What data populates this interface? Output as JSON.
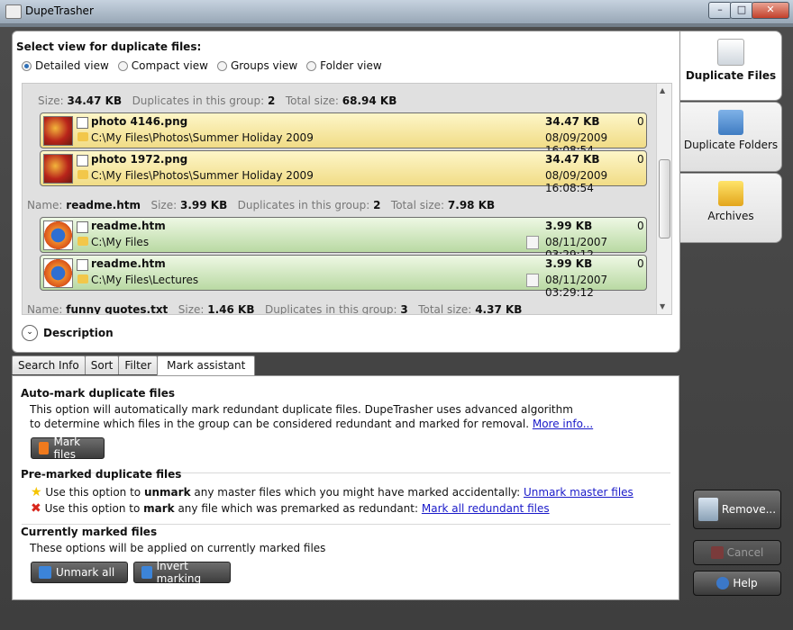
{
  "window": {
    "title": "DupeTrasher",
    "min": "–",
    "max": "□",
    "close": "✕"
  },
  "view": {
    "prompt": "Select view for duplicate files:",
    "options": [
      "Detailed view",
      "Compact view",
      "Groups view",
      "Folder view"
    ],
    "selected": "Detailed view"
  },
  "list": {
    "group1": {
      "size_label": "Size:",
      "size": "34.47 KB",
      "dup_label": "Duplicates in this group:",
      "dup": "2",
      "total_label": "Total size:",
      "total": "68.94 KB"
    },
    "rows": [
      {
        "name": "photo 4146.png",
        "path": "C:\\My Files\\Photos\\Summer Holiday 2009",
        "size": "34.47 KB",
        "count": "0",
        "date": "08/09/2009 16:08:54"
      },
      {
        "name": "photo 1972.png",
        "path": "C:\\My Files\\Photos\\Summer Holiday 2009",
        "size": "34.47 KB",
        "count": "0",
        "date": "08/09/2009 16:08:54"
      },
      {
        "name": "readme.htm",
        "path": "C:\\My Files",
        "size": "3.99 KB",
        "count": "0",
        "date": "08/11/2007 03:29:12"
      },
      {
        "name": "readme.htm",
        "path": "C:\\My Files\\Lectures",
        "size": "3.99 KB",
        "count": "0",
        "date": "08/11/2007 03:29:12"
      }
    ],
    "group2": {
      "name_label": "Name:",
      "name": "readme.htm",
      "size_label": "Size:",
      "size": "3.99 KB",
      "dup_label": "Duplicates in this group:",
      "dup": "2",
      "total_label": "Total size:",
      "total": "7.98 KB"
    },
    "group3": {
      "name_label": "Name:",
      "name": "funny quotes.txt",
      "size_label": "Size:",
      "size": "1.46 KB",
      "dup_label": "Duplicates in this group:",
      "dup": "3",
      "total_label": "Total size:",
      "total": "4.37 KB"
    }
  },
  "description_label": "Description",
  "tabs": [
    "Search Info",
    "Sort",
    "Filter",
    "Mark assistant"
  ],
  "active_tab": "Mark assistant",
  "auto_mark": {
    "title": "Auto-mark duplicate files",
    "line1": "This option will automatically mark redundant duplicate files. DupeTrasher uses advanced algorithm",
    "line2": "to determine which files in the group can be considered redundant and marked for removal.",
    "more": "More info...",
    "button": "Mark files"
  },
  "pre_marked": {
    "title": "Pre-marked duplicate files",
    "unmark_pre": "Use this option to ",
    "unmark_bold": "unmark",
    "unmark_post": " any master files which you might have marked accidentally: ",
    "unmark_link": "Unmark master files",
    "mark_pre": "Use this option to ",
    "mark_bold": "mark",
    "mark_post": " any file which was premarked as redundant: ",
    "mark_link": "Mark all redundant files"
  },
  "currently": {
    "title": "Currently marked files",
    "desc": "These options will be applied on currently marked files",
    "unmark_all": "Unmark all",
    "invert": "Invert marking"
  },
  "side_tabs": [
    "Duplicate Files",
    "Duplicate Folders",
    "Archives"
  ],
  "actions": {
    "remove": "Remove...",
    "cancel": "Cancel",
    "help": "Help"
  },
  "colors": {
    "accent": "#2e6fb7",
    "yellow_row": "#f1dc86",
    "green_row": "#b9d9a3",
    "link": "#1a1ac9"
  }
}
